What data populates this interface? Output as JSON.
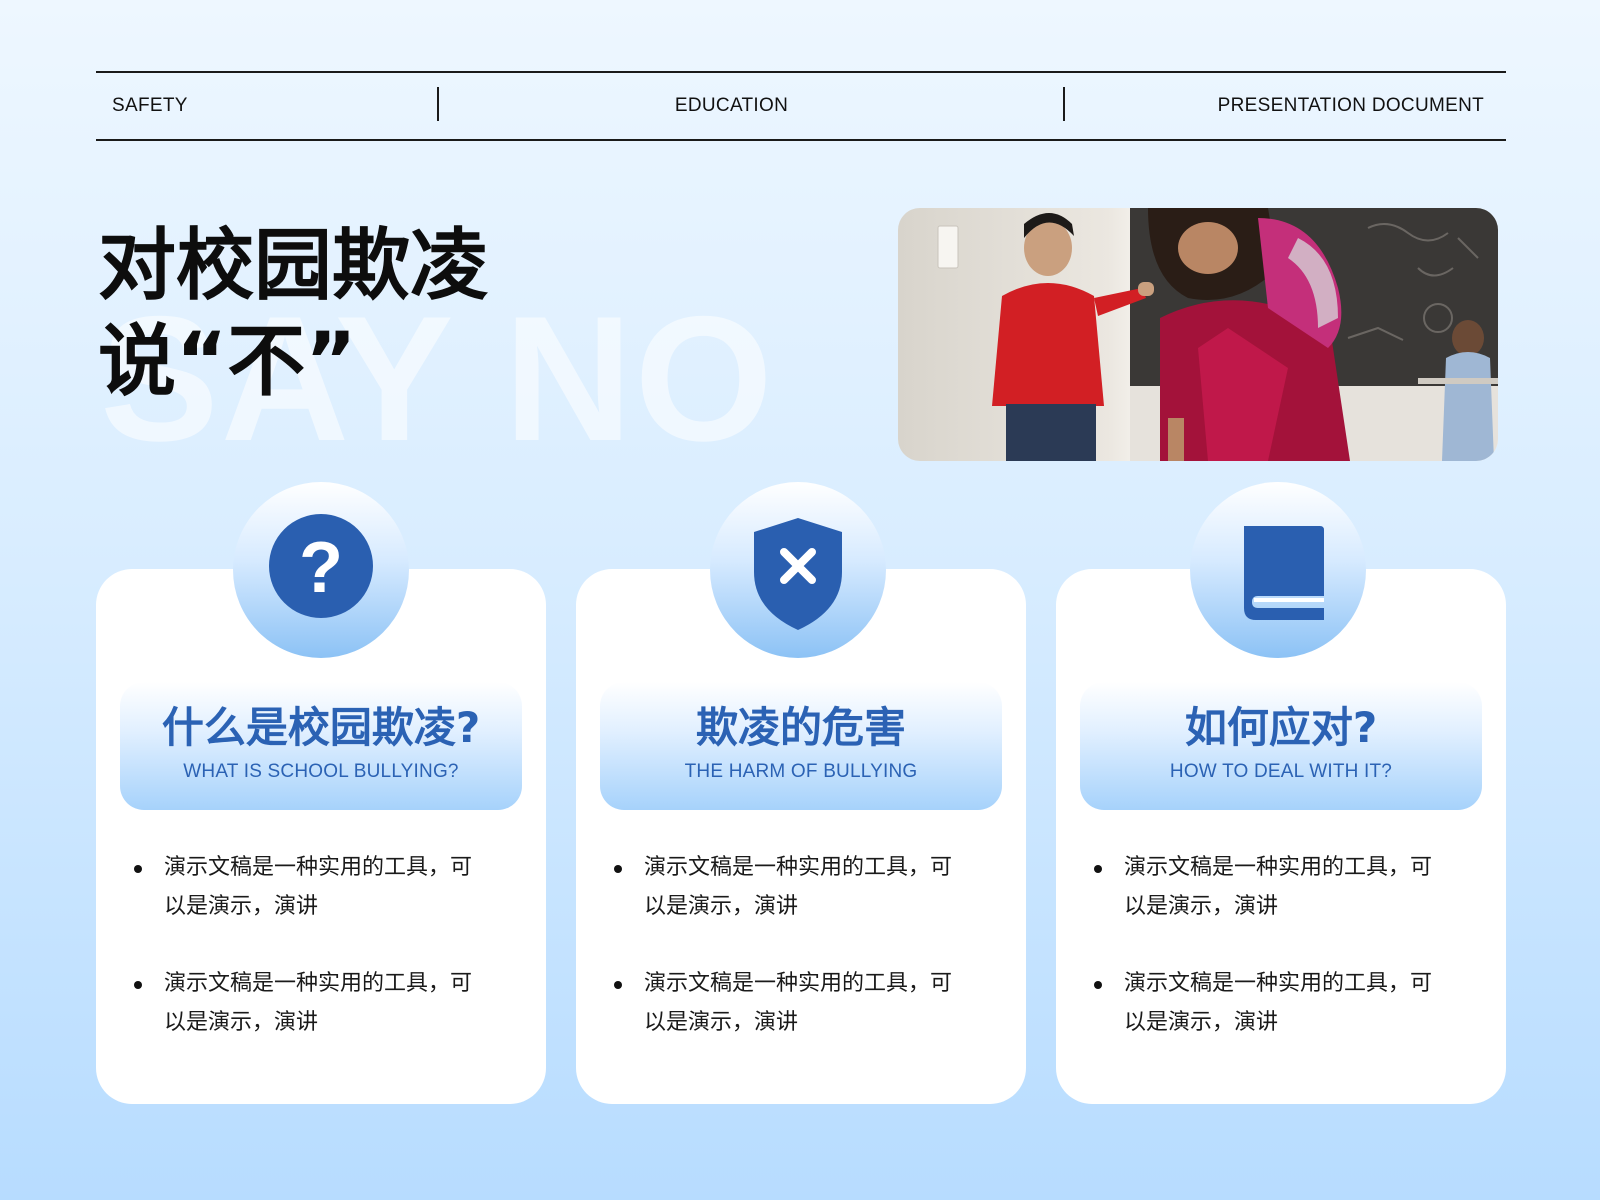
{
  "header": {
    "left": "SAFETY",
    "center": "EDUCATION",
    "right": "PRESENTATION DOCUMENT"
  },
  "title": {
    "line1": "对校园欺凌",
    "line2": "说“不”",
    "watermark": "SAY NO"
  },
  "photo": {
    "description_icon": "students-photo"
  },
  "cards": [
    {
      "icon": "question-circle-icon",
      "title_zh": "什么是校园欺凌?",
      "title_en": "WHAT IS SCHOOL BULLYING?",
      "bullets": [
        "演示文稿是一种实用的工具，可以是演示，演讲",
        "演示文稿是一种实用的工具，可以是演示，演讲"
      ]
    },
    {
      "icon": "shield-x-icon",
      "title_zh": "欺凌的危害",
      "title_en": "THE HARM OF BULLYING",
      "bullets": [
        "演示文稿是一种实用的工具，可以是演示，演讲",
        "演示文稿是一种实用的工具，可以是演示，演讲"
      ]
    },
    {
      "icon": "book-icon",
      "title_zh": "如何应对?",
      "title_en": "HOW TO DEAL WITH IT?",
      "bullets": [
        "演示文稿是一种实用的工具，可以是演示，演讲",
        "演示文稿是一种实用的工具，可以是演示，演讲"
      ]
    }
  ],
  "colors": {
    "accent": "#2b62b4",
    "icon": "#2a5fb0"
  }
}
